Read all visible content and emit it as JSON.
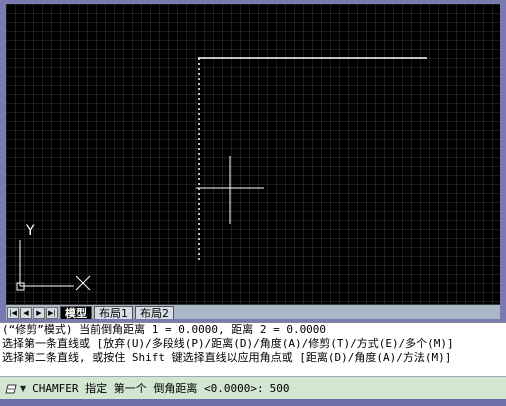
{
  "drawing": {
    "ucs_axis_label": "Y",
    "colors": {
      "background": "#000000",
      "geometry": "#ffffff",
      "grid": "#333333"
    }
  },
  "tabs": {
    "nav_buttons": [
      "|◀",
      "◀",
      "▶",
      "▶|"
    ],
    "model_label": "模型",
    "layout1_label": "布局1",
    "layout2_label": "布局2"
  },
  "command": {
    "history": [
      "(“修剪”模式) 当前倒角距离 1 = 0.0000, 距离 2 = 0.0000",
      "选择第一条直线或 [放弃(U)/多段线(P)/距离(D)/角度(A)/修剪(T)/方式(E)/多个(M)]",
      "选择第二条直线, 或按住 Shift 键选择直线以应用角点或 [距离(D)/角度(A)/方法(M)]"
    ],
    "prompt": "CHAMFER 指定 第一个 倒角距离 <0.0000>:",
    "value": "500",
    "icon_name": "command-line-icon",
    "arrow_name": "dropdown-arrow-icon"
  }
}
